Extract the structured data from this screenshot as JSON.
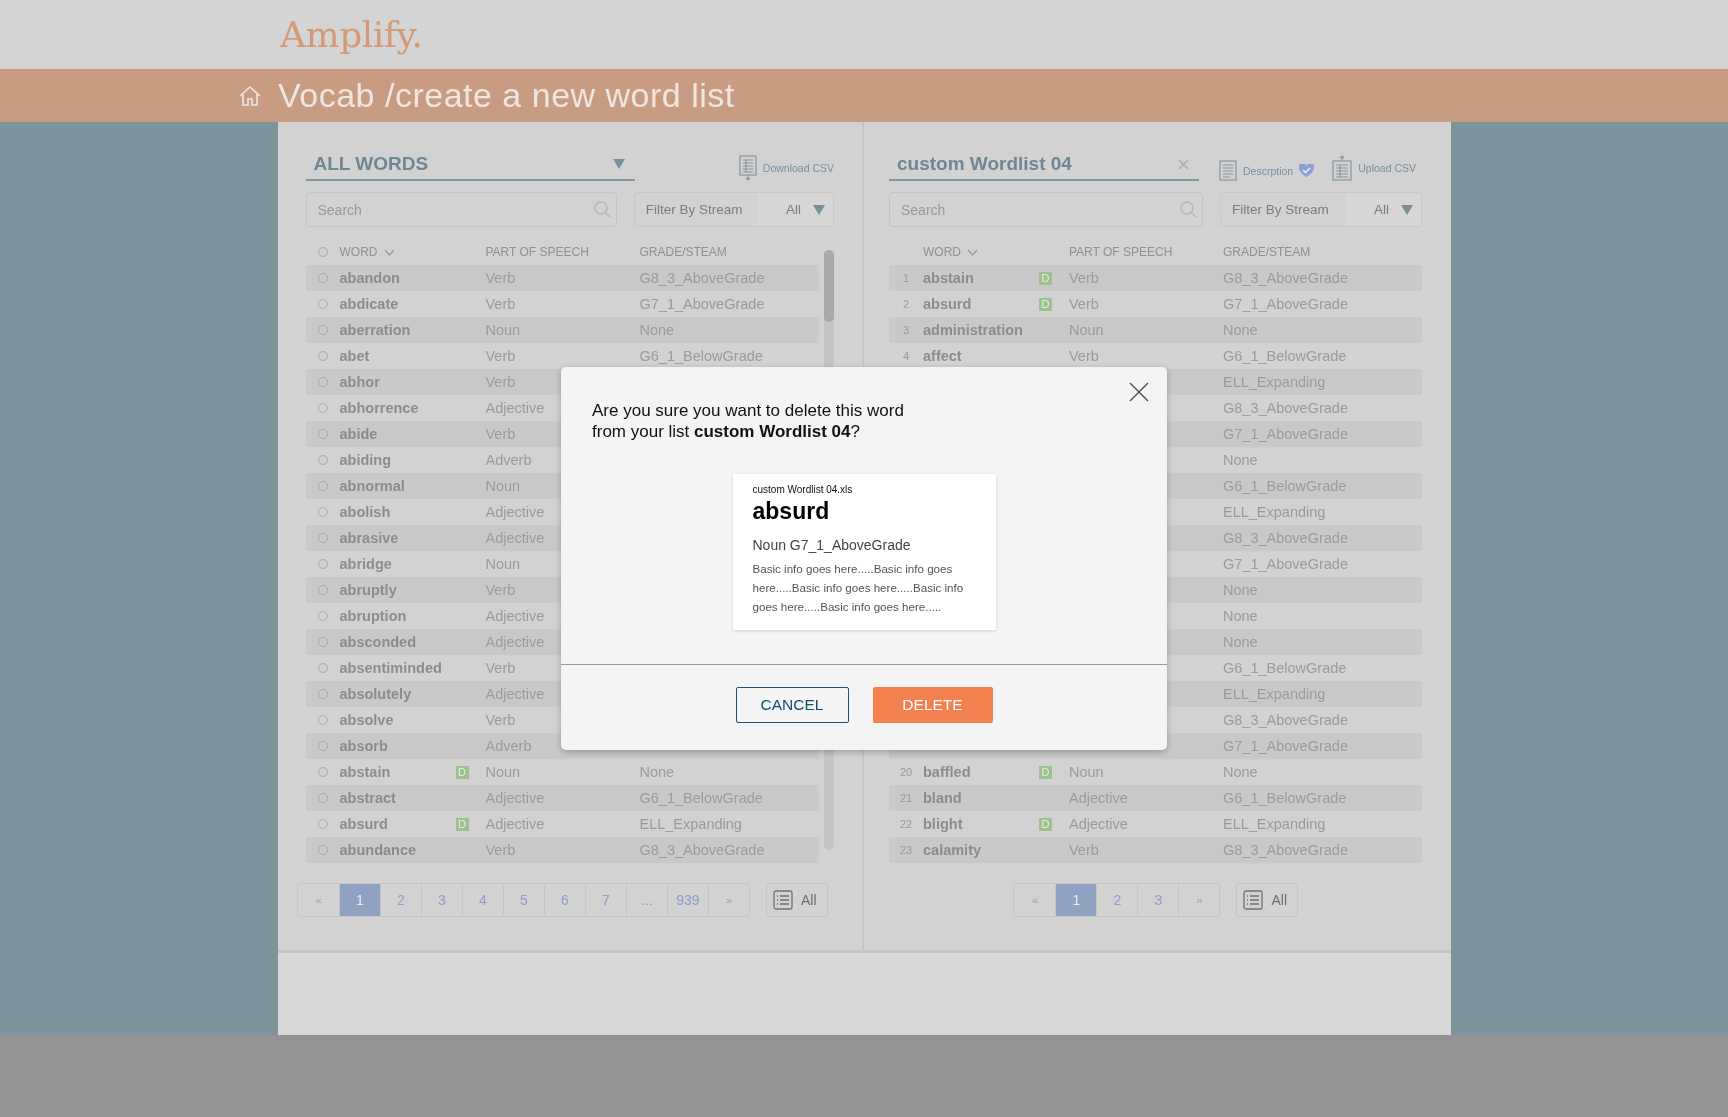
{
  "logo": "Amplify.",
  "breadcrumb": "Vocab /create a new word list",
  "panes": [
    {
      "list_select": {
        "label": "ALL WORDS",
        "kind": "dropdown"
      },
      "scrollable": true,
      "actions": [
        {
          "kind": "download",
          "label": "Download CSV"
        }
      ],
      "search": {
        "placeholder": "Search"
      },
      "filter": {
        "label": "Filter By Stream",
        "value": "All"
      },
      "header_checked": false,
      "columns": [
        "WORD",
        "PART OF SPEECH",
        "GRADE/STEAM"
      ],
      "rows": [
        {
          "word": "abandon",
          "part_of_speech": "Verb",
          "grade": "G8_3_AboveGrade",
          "checked": false
        },
        {
          "word": "abdicate",
          "part_of_speech": "Verb",
          "grade": "G7_1_AboveGrade",
          "checked": false
        },
        {
          "word": "aberration",
          "part_of_speech": "Noun",
          "grade": "None",
          "checked": false
        },
        {
          "word": "abet",
          "part_of_speech": "Verb",
          "grade": "G6_1_BelowGrade",
          "checked": false
        },
        {
          "word": "abhor",
          "part_of_speech": "Verb",
          "checked": false
        },
        {
          "word": "abhorrence",
          "part_of_speech": "Adjective",
          "checked": false
        },
        {
          "word": "abide",
          "part_of_speech": "Verb",
          "checked": false
        },
        {
          "word": "abiding",
          "part_of_speech": "Adverb",
          "checked": false
        },
        {
          "word": "abnormal",
          "part_of_speech": "Noun",
          "checked": false
        },
        {
          "word": "abolish",
          "part_of_speech": "Adjective",
          "checked": false
        },
        {
          "word": "abrasive",
          "part_of_speech": "Adjective",
          "checked": false
        },
        {
          "word": "abridge",
          "part_of_speech": "Noun",
          "checked": false
        },
        {
          "word": "abruptly",
          "part_of_speech": "Verb",
          "checked": false
        },
        {
          "word": "abruption",
          "part_of_speech": "Adjective",
          "checked": false
        },
        {
          "word": "absconded",
          "part_of_speech": "Adjective",
          "checked": false
        },
        {
          "word": "absentiminded",
          "part_of_speech": "Verb",
          "checked": false
        },
        {
          "word": "absolutely",
          "part_of_speech": "Adjective",
          "checked": false
        },
        {
          "word": "absolve",
          "part_of_speech": "Verb",
          "checked": false
        },
        {
          "word": "absorb",
          "part_of_speech": "Adverb",
          "checked": false
        },
        {
          "word": "abstain",
          "badge": "D",
          "part_of_speech": "Noun",
          "grade": "None",
          "checked": false
        },
        {
          "word": "abstract",
          "part_of_speech": "Adjective",
          "grade": "G6_1_BelowGrade",
          "checked": false
        },
        {
          "word": "absurd",
          "badge": "D",
          "part_of_speech": "Adjective",
          "grade": "ELL_Expanding",
          "checked": false
        },
        {
          "word": "abundance",
          "part_of_speech": "Verb",
          "grade": "G8_3_AboveGrade",
          "checked": false
        }
      ],
      "pagination": {
        "pages": [
          {
            "label": "«",
            "selected": false
          },
          {
            "label": "1",
            "selected": true
          },
          {
            "label": "2",
            "selected": false
          },
          {
            "label": "3",
            "selected": false
          },
          {
            "label": "4",
            "selected": false
          },
          {
            "label": "5",
            "selected": false
          },
          {
            "label": "6",
            "selected": false
          },
          {
            "label": "7",
            "selected": false
          },
          {
            "label": "...",
            "selected": false
          },
          {
            "label": "939",
            "selected": false
          },
          {
            "label": "»",
            "selected": false
          }
        ],
        "all": "All"
      }
    },
    {
      "list_select": {
        "label": "custom Wordlist 04",
        "kind": "clear"
      },
      "actions": [
        {
          "kind": "description",
          "label": "Descrption"
        },
        {
          "kind": "upload",
          "label": "Upload CSV"
        }
      ],
      "search": {
        "placeholder": "Search"
      },
      "filter": {
        "label": "Filter By Stream",
        "value": "All"
      },
      "columns": [
        "WORD",
        "PART OF SPEECH",
        "GRADE/STEAM"
      ],
      "rows": [
        {
          "index": "1",
          "word": "abstain",
          "badge": "D",
          "part_of_speech": "Verb",
          "grade": "G8_3_AboveGrade"
        },
        {
          "index": "2",
          "word": "absurd",
          "badge": "D",
          "part_of_speech": "Verb",
          "grade": "G7_1_AboveGrade"
        },
        {
          "index": "3",
          "word": "administration",
          "part_of_speech": "Noun",
          "grade": "None"
        },
        {
          "index": "4",
          "word": "affect",
          "part_of_speech": "Verb",
          "grade": "G6_1_BelowGrade"
        },
        {
          "grade": "ELL_Expanding"
        },
        {
          "grade": "G8_3_AboveGrade"
        },
        {
          "grade": "G7_1_AboveGrade"
        },
        {
          "grade": "None"
        },
        {
          "grade": "G6_1_BelowGrade"
        },
        {
          "grade": "ELL_Expanding"
        },
        {
          "grade": "G8_3_AboveGrade"
        },
        {
          "grade": "G7_1_AboveGrade"
        },
        {
          "grade": "None"
        },
        {
          "grade": "None"
        },
        {
          "grade": "None"
        },
        {
          "grade": "G6_1_BelowGrade"
        },
        {
          "grade": "ELL_Expanding"
        },
        {
          "grade": "G8_3_AboveGrade"
        },
        {
          "grade": "G7_1_AboveGrade"
        },
        {
          "index": "20",
          "word": "baffled",
          "badge": "D",
          "part_of_speech": "Noun",
          "grade": "None"
        },
        {
          "index": "21",
          "word": "bland",
          "part_of_speech": "Adjective",
          "grade": "G6_1_BelowGrade"
        },
        {
          "index": "22",
          "word": "blight",
          "badge": "D",
          "part_of_speech": "Adjective",
          "grade": "ELL_Expanding"
        },
        {
          "index": "23",
          "word": "calamity",
          "part_of_speech": "Verb",
          "grade": "G8_3_AboveGrade"
        }
      ],
      "pagination": {
        "pages": [
          {
            "label": "«",
            "selected": false
          },
          {
            "label": "1",
            "selected": true
          },
          {
            "label": "2",
            "selected": false
          },
          {
            "label": "3",
            "selected": false
          },
          {
            "label": "»",
            "selected": false
          }
        ],
        "all": "All"
      }
    }
  ],
  "dialog": {
    "message": "Are you sure you want to delete this word from your list **custom Wordlist 04**?",
    "card": {
      "file": "custom Wordlist 04.xls",
      "word": "absurd",
      "meta": "Noun G7_1_AboveGrade",
      "info": "Basic info goes here.....Basic info goes here.....Basic info goes here.....Basic info goes here.....Basic info goes here....."
    },
    "buttons": [
      {
        "kind": "cancel",
        "label": "CANCEL"
      },
      {
        "kind": "delete",
        "label": "DELETE"
      }
    ]
  }
}
